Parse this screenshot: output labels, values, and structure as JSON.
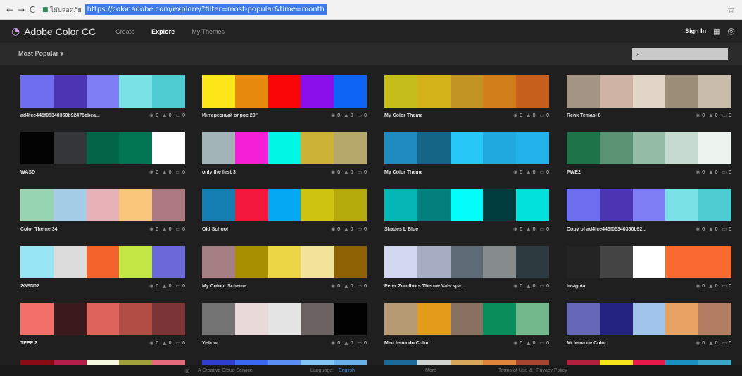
{
  "browser": {
    "back": "←",
    "forward": "→",
    "reload": "C",
    "security_text": "ไม่ปลอดภัย",
    "url": "https://color.adobe.com/explore/?filter=most-popular&time=month"
  },
  "header": {
    "brand": "Adobe Color CC",
    "nav": [
      "Create",
      "Explore",
      "My Themes"
    ],
    "active_nav": "Explore",
    "signin": "Sign In"
  },
  "filter": {
    "selected": "Most Popular",
    "search_placeholder": ""
  },
  "stats_icons": {
    "views": "eye-icon",
    "likes": "thumb-up-icon",
    "comments": "comment-icon"
  },
  "themes": [
    {
      "title": "ad4fce445f05340350b92478ebea...",
      "colors": [
        "#6e6ef0",
        "#4b35b0",
        "#7f7ef5",
        "#79e2e4",
        "#4fccd2"
      ],
      "views": "0",
      "likes": "0",
      "comments": "0"
    },
    {
      "title": "Интересный опрос 20\"",
      "colors": [
        "#fde71b",
        "#e88a0e",
        "#f90505",
        "#8a0fe8",
        "#0e64f5"
      ],
      "views": "0",
      "likes": "0",
      "comments": "0"
    },
    {
      "title": "My Color Theme",
      "colors": [
        "#c5bd1a",
        "#d4b31a",
        "#c09323",
        "#d07f1b",
        "#c7601c"
      ],
      "views": "0",
      "likes": "0",
      "comments": "0"
    },
    {
      "title": "Renk Teması 8",
      "colors": [
        "#a39483",
        "#cfb3a5",
        "#e2d4c6",
        "#9b8d78",
        "#cabcaa"
      ],
      "views": "0",
      "likes": "0",
      "comments": "0"
    },
    {
      "title": "WASD",
      "colors": [
        "#030303",
        "#343638",
        "#026646",
        "#027652",
        "#ffffff"
      ],
      "views": "0",
      "likes": "0",
      "comments": "0"
    },
    {
      "title": "only the first 3",
      "colors": [
        "#a2b4b8",
        "#f51fd6",
        "#00f6e5",
        "#ccb337",
        "#b5a86a"
      ],
      "views": "0",
      "likes": "0",
      "comments": "0"
    },
    {
      "title": "My Color Theme",
      "colors": [
        "#1f8bc0",
        "#156686",
        "#27c7f8",
        "#1ea8de",
        "#22b3ea"
      ],
      "views": "0",
      "likes": "0",
      "comments": "0"
    },
    {
      "title": "PWE2",
      "colors": [
        "#1e7448",
        "#5a9373",
        "#94bba5",
        "#c6dad0",
        "#edf3ee"
      ],
      "views": "0",
      "likes": "0",
      "comments": "0"
    },
    {
      "title": "Color Theme 34",
      "colors": [
        "#97d5b0",
        "#a6cde8",
        "#e8b1b8",
        "#f9c77c",
        "#ad7a84"
      ],
      "views": "0",
      "likes": "0",
      "comments": "0"
    },
    {
      "title": "Old School",
      "colors": [
        "#157fb3",
        "#f3173e",
        "#04a9f1",
        "#cdc412",
        "#b5aa0b"
      ],
      "views": "0",
      "likes": "0",
      "comments": "0"
    },
    {
      "title": "Shades L Blue",
      "colors": [
        "#05b8b7",
        "#027e7c",
        "#02fdfb",
        "#013c3c",
        "#03e1dd"
      ],
      "views": "0",
      "likes": "0",
      "comments": "0"
    },
    {
      "title": "Copy of ad4fce445f05340350b92...",
      "colors": [
        "#6e6ef0",
        "#4b35b0",
        "#7f7ef5",
        "#79e2e4",
        "#4fccd2"
      ],
      "views": "0",
      "likes": "0",
      "comments": "0"
    },
    {
      "title": "2GSN02",
      "colors": [
        "#98e6f5",
        "#dcdcdc",
        "#f2642b",
        "#c3e846",
        "#6c6ad8"
      ],
      "views": "0",
      "likes": "0",
      "comments": "0"
    },
    {
      "title": "My Colour Scheme",
      "colors": [
        "#a67f84",
        "#a88f02",
        "#ecd544",
        "#f1e39a",
        "#8e6204"
      ],
      "views": "0",
      "likes": "0",
      "comments": "0"
    },
    {
      "title": "Peter Zumthors Therme Vals spa ...",
      "colors": [
        "#d3d8f0",
        "#a7aec3",
        "#5e6b76",
        "#868b8c",
        "#2d3a40"
      ],
      "views": "0",
      "likes": "0",
      "comments": "0"
    },
    {
      "title": "Insignia",
      "colors": [
        "#242424",
        "#444444",
        "#ffffff",
        "#f96a31",
        "#f96a31"
      ],
      "views": "0",
      "likes": "0",
      "comments": "0"
    },
    {
      "title": "TEEF 2",
      "colors": [
        "#f36f6a",
        "#3a1a1c",
        "#de635c",
        "#b24d46",
        "#7c3536"
      ],
      "views": "0",
      "likes": "0",
      "comments": "0"
    },
    {
      "title": "Yellow",
      "colors": [
        "#737373",
        "#e9dada",
        "#e5e5e5",
        "#6b6262",
        "#020202"
      ],
      "views": "0",
      "likes": "0",
      "comments": "0"
    },
    {
      "title": "Meu tema do Color",
      "colors": [
        "#b69a73",
        "#e39b1b",
        "#897262",
        "#0a8e5c",
        "#73b78d"
      ],
      "views": "0",
      "likes": "0",
      "comments": "0"
    },
    {
      "title": "Mi tema de Color",
      "colors": [
        "#6667b7",
        "#242480",
        "#a1c4ea",
        "#eaa263",
        "#b37d64"
      ],
      "views": "0",
      "likes": "0",
      "comments": "0"
    },
    {
      "title": "",
      "colors": [
        "#8a0a14",
        "#b31f4a",
        "#f5f9e0",
        "#9fa03a",
        "#e4697a"
      ],
      "views": "",
      "likes": "",
      "comments": ""
    },
    {
      "title": "",
      "colors": [
        "#2f3ecf",
        "#3a68f0",
        "#5a8ef0",
        "#82c6f5",
        "#6ab0e8"
      ],
      "views": "",
      "likes": "",
      "comments": ""
    },
    {
      "title": "",
      "colors": [
        "#1b6a9c",
        "#cfd4d0",
        "#d8a85a",
        "#e0853c",
        "#a84631"
      ],
      "views": "",
      "likes": "",
      "comments": ""
    },
    {
      "title": "",
      "colors": [
        "#b01f3c",
        "#f8e41a",
        "#e6194a",
        "#1a8fc2",
        "#3aa6c8"
      ],
      "views": "",
      "likes": "",
      "comments": ""
    }
  ],
  "footer": {
    "service": "A Creative Cloud Service",
    "language_label": "Language:",
    "language_value": "English",
    "more": "More",
    "terms": "Terms of Use",
    "amp": "&",
    "privacy": "Privacy Policy"
  }
}
